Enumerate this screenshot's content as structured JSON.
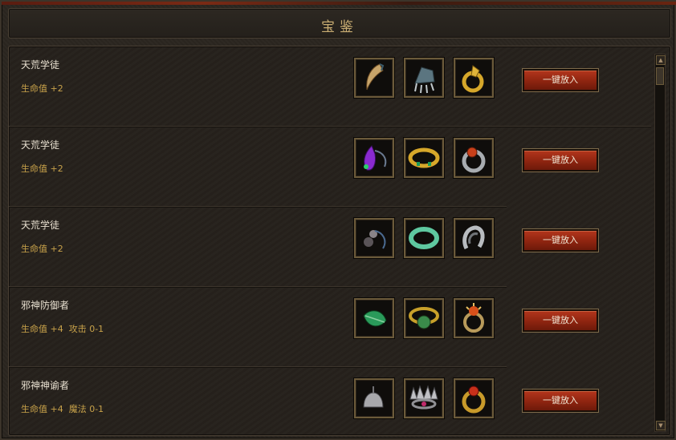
{
  "window": {
    "title": "宝鉴"
  },
  "rows": [
    {
      "name": "天荒学徒",
      "stats": "生命值 +2",
      "button": "一键放入",
      "items": [
        "fang-necklace-icon",
        "clawed-gauntlet-icon",
        "gold-dragon-ring-icon"
      ]
    },
    {
      "name": "天荒学徒",
      "stats": "生命值 +2",
      "button": "一键放入",
      "items": [
        "purple-gem-pendant-icon",
        "gold-jeweled-bracelet-icon",
        "red-gem-silver-ring-icon"
      ]
    },
    {
      "name": "天荒学徒",
      "stats": "生命值 +2",
      "button": "一键放入",
      "items": [
        "dark-beaded-necklace-icon",
        "jade-bangle-icon",
        "silver-twisted-ring-icon"
      ]
    },
    {
      "name": "邪神防御者",
      "stats": "生命值 +4  攻击 0-1",
      "button": "一键放入",
      "items": [
        "green-leaf-pendant-icon",
        "green-demon-bracelet-icon",
        "spiked-ruby-ring-icon"
      ]
    },
    {
      "name": "邪神神谕者",
      "stats": "生命值 +4  魔法 0-1",
      "button": "一键放入",
      "items": [
        "silver-bell-necklace-icon",
        "spiked-crown-bracelet-icon",
        "gold-ruby-ring-icon"
      ]
    }
  ],
  "colors": {
    "accent": "#c8a24a",
    "button": "#a02c14",
    "title": "#c9ad72"
  }
}
